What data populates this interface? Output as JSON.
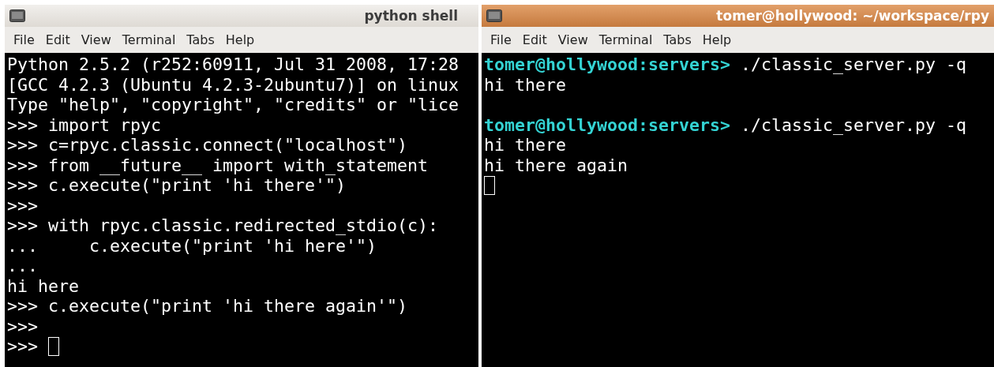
{
  "windows": [
    {
      "title": "python shell",
      "active": false,
      "menu": [
        "File",
        "Edit",
        "View",
        "Terminal",
        "Tabs",
        "Help"
      ],
      "lines": [
        {
          "kind": "text",
          "text": "Python 2.5.2 (r252:60911, Jul 31 2008, 17:28"
        },
        {
          "kind": "text",
          "text": "[GCC 4.2.3 (Ubuntu 4.2.3-2ubuntu7)] on linux"
        },
        {
          "kind": "text",
          "text": "Type \"help\", \"copyright\", \"credits\" or \"lice"
        },
        {
          "kind": "text",
          "text": ">>> import rpyc"
        },
        {
          "kind": "text",
          "text": ">>> c=rpyc.classic.connect(\"localhost\")"
        },
        {
          "kind": "text",
          "text": ">>> from __future__ import with_statement"
        },
        {
          "kind": "text",
          "text": ">>> c.execute(\"print 'hi there'\")"
        },
        {
          "kind": "text",
          "text": ">>>"
        },
        {
          "kind": "text",
          "text": ">>> with rpyc.classic.redirected_stdio(c):"
        },
        {
          "kind": "text",
          "text": "...     c.execute(\"print 'hi here'\")"
        },
        {
          "kind": "text",
          "text": "..."
        },
        {
          "kind": "text",
          "text": "hi here"
        },
        {
          "kind": "text",
          "text": ">>> c.execute(\"print 'hi there again'\")"
        },
        {
          "kind": "text",
          "text": ">>>"
        },
        {
          "kind": "cursor",
          "text": ">>> "
        }
      ]
    },
    {
      "title": "tomer@hollywood: ~/workspace/rpy",
      "active": true,
      "menu": [
        "File",
        "Edit",
        "View",
        "Terminal",
        "Tabs",
        "Help"
      ],
      "lines": [
        {
          "kind": "prompt",
          "prompt": "tomer@hollywood:servers>",
          "command": " ./classic_server.py -q"
        },
        {
          "kind": "text",
          "text": "hi there"
        },
        {
          "kind": "blank"
        },
        {
          "kind": "prompt",
          "prompt": "tomer@hollywood:servers>",
          "command": " ./classic_server.py -q"
        },
        {
          "kind": "text",
          "text": "hi there"
        },
        {
          "kind": "text",
          "text": "hi there again"
        },
        {
          "kind": "cursor"
        }
      ]
    }
  ]
}
